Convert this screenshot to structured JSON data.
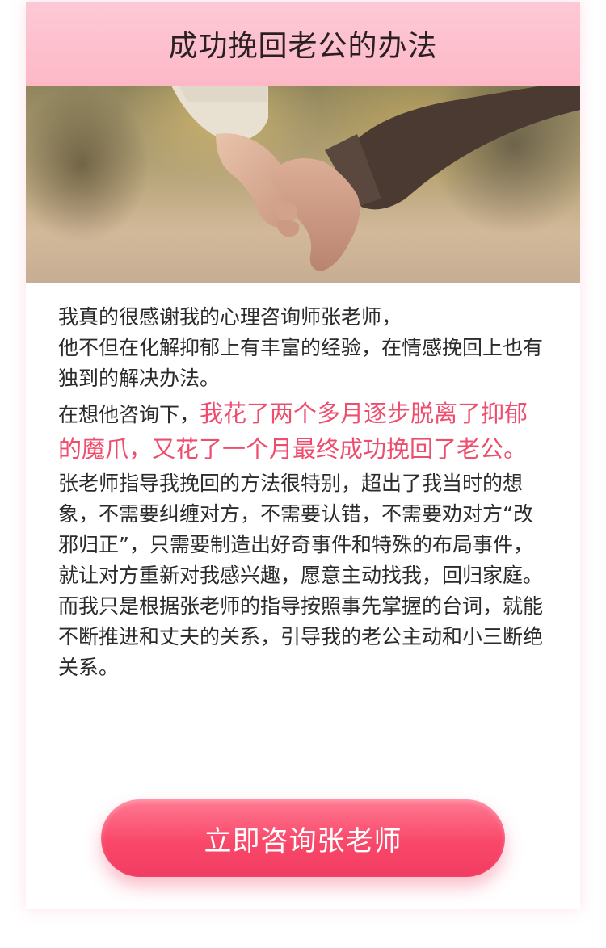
{
  "header": {
    "title": "成功挽回老公的办法"
  },
  "hero": {
    "image_alt": "holding-hands-photo"
  },
  "content": {
    "line1": "我真的很感谢我的心理咨询师张老师，",
    "line2": "他不但在化解抑郁上有丰富的经验，在情感挽回上也有独到的解决办法。",
    "p2_prefix": "在想他咨询下，",
    "p2_highlight": "我花了两个多月逐步脱离了抑郁的魔爪，又花了一个月最终成功挽回了老公。",
    "p3": "张老师指导我挽回的方法很特别，超出了我当时的想象，不需要纠缠对方，不需要认错，不需要劝对方“改邪归正”，只需要制造出好奇事件和特殊的布局事件，就让对方重新对我感兴趣，愿意主动找我，回归家庭。",
    "p4": "而我只是根据张老师的指导按照事先掌握的台词，就能不断推进和丈夫的关系，引导我的老公主动和小三断绝关系。"
  },
  "cta": {
    "label": "立即咨询张老师"
  },
  "colors": {
    "header_bg": "#fdc0cf",
    "highlight": "#ee4d6e",
    "cta": "#f9486a"
  }
}
